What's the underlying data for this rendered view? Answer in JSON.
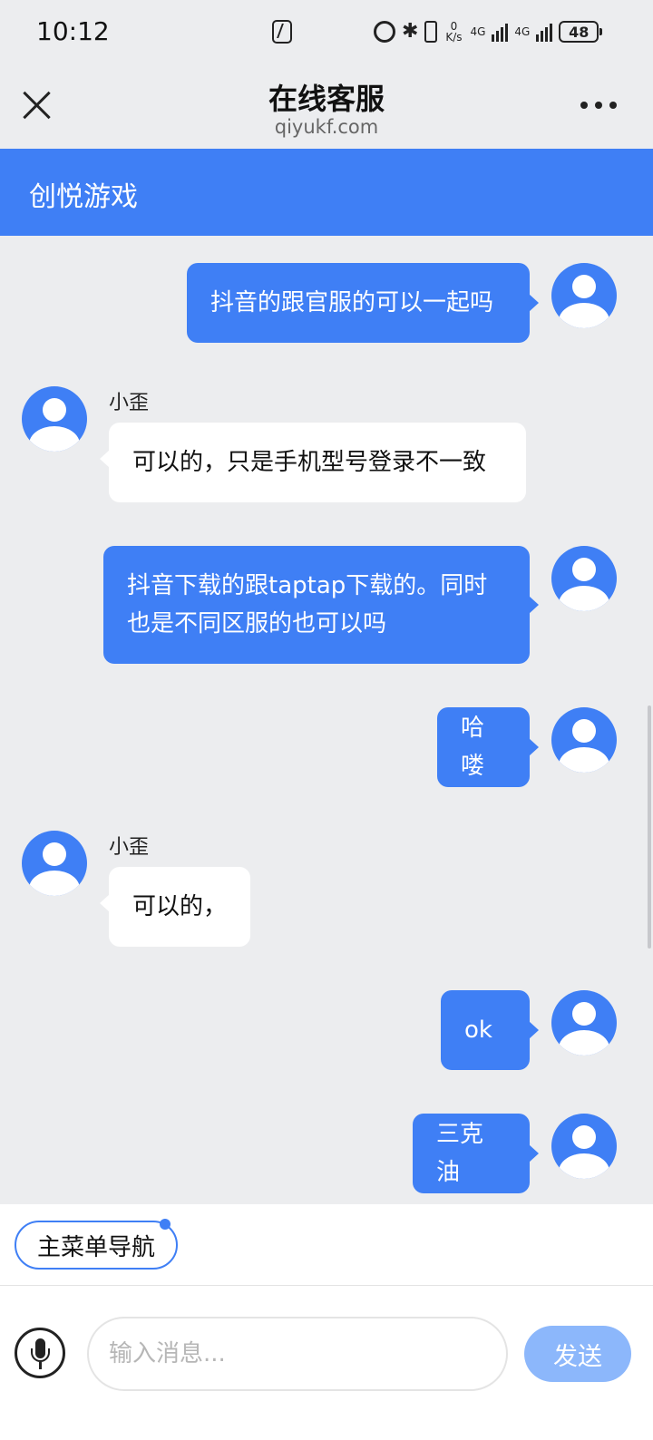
{
  "status_bar": {
    "time": "10:12",
    "net_speed": "0\nK/s",
    "net_type_1": "4G",
    "net_type_2": "4G",
    "battery": "48",
    "icons": [
      "nfc-icon",
      "alarm-icon",
      "bluetooth-icon",
      "vibrate-icon",
      "signal-icon",
      "battery-icon"
    ]
  },
  "header": {
    "title": "在线客服",
    "subtitle": "qiyukf.com"
  },
  "brand": {
    "name": "创悦游戏",
    "color": "#3f7ff5"
  },
  "messages": [
    {
      "direction": "out",
      "text": "抖音的跟官服的可以一起吗"
    },
    {
      "direction": "in",
      "sender": "小歪",
      "text": "可以的，只是手机型号登录不一致"
    },
    {
      "direction": "out",
      "text_line1": "抖音下载的跟taptap下载的。同时",
      "text_line2": "也是不同区服的也可以吗"
    },
    {
      "direction": "out",
      "text": "哈喽"
    },
    {
      "direction": "in",
      "sender": "小歪",
      "text": "可以的，"
    },
    {
      "direction": "out",
      "text": "ok"
    },
    {
      "direction": "out",
      "text": "三克油"
    }
  ],
  "quick_menu": {
    "label": "主菜单导航"
  },
  "input_bar": {
    "placeholder": "输入消息...",
    "value": "",
    "send_label": "发送"
  }
}
